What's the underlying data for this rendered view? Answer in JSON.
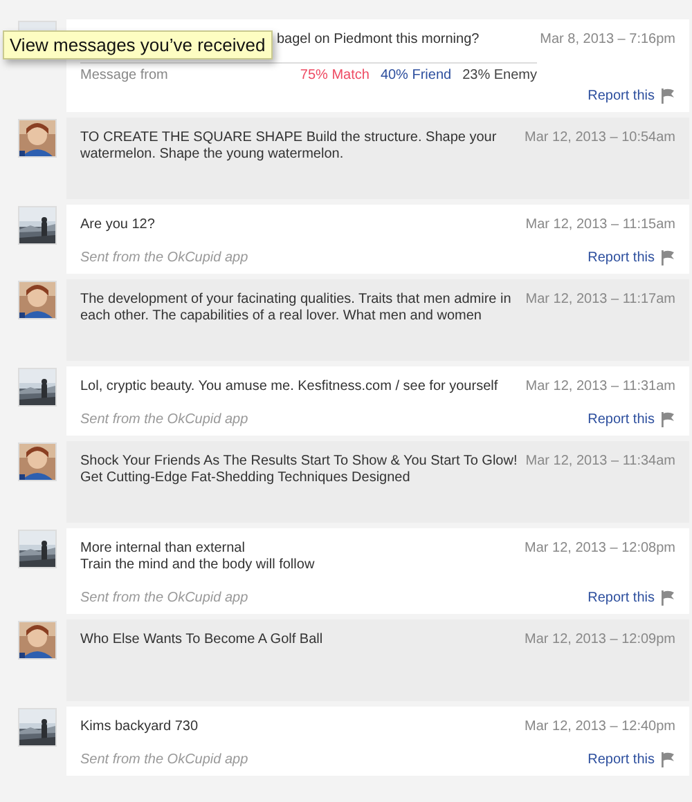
{
  "tooltip": {
    "text": "View messages you’ve received"
  },
  "messages": [
    {
      "kind": "received",
      "text": "bagel on Piedmont this morning?",
      "date": "Mar 8, 2013 – 7:16pm",
      "footer": "Message from",
      "match_stats": [
        {
          "text": "75% Match",
          "color": "#ee4b63"
        },
        {
          "text": "40% Friend",
          "color": "#2d4f9e"
        },
        {
          "text": "23% Enemy",
          "color": "#444444"
        }
      ],
      "report": "Report this"
    },
    {
      "kind": "sent",
      "text": "TO CREATE THE SQUARE SHAPE Build the structure. Shape your watermelon. Shape the young watermelon.",
      "date": "Mar 12, 2013 – 10:54am"
    },
    {
      "kind": "received",
      "text": "Are you 12?",
      "date": "Mar 12, 2013 – 11:15am",
      "footer": "Sent from the OkCupid app",
      "report": "Report this"
    },
    {
      "kind": "sent",
      "text": "The development of your facinating qualities. Traits that men admire in each other. The capabilities of a real lover. What men and women",
      "date": "Mar 12, 2013 – 11:17am"
    },
    {
      "kind": "received",
      "text": "Lol, cryptic beauty. You amuse me. Kesfitness.com / see for yourself",
      "date": "Mar 12, 2013 – 11:31am",
      "footer": "Sent from the OkCupid app",
      "report": "Report this"
    },
    {
      "kind": "sent",
      "text": "Shock Your Friends As The Results Start To Show & You Start To Glow! Get Cutting-Edge Fat-Shedding Techniques Designed",
      "date": "Mar 12, 2013 – 11:34am"
    },
    {
      "kind": "received",
      "text": "More internal than external\nTrain the mind and the body will follow",
      "date": "Mar 12, 2013 – 12:08pm",
      "footer": "Sent from the OkCupid app",
      "report": "Report this"
    },
    {
      "kind": "sent",
      "text": "Who Else Wants To Become A Golf Ball",
      "date": "Mar 12, 2013 – 12:09pm"
    },
    {
      "kind": "received",
      "text": "Kims backyard 730",
      "date": "Mar 12, 2013 – 12:40pm",
      "footer": "Sent from the OkCupid app",
      "report": "Report this"
    }
  ]
}
